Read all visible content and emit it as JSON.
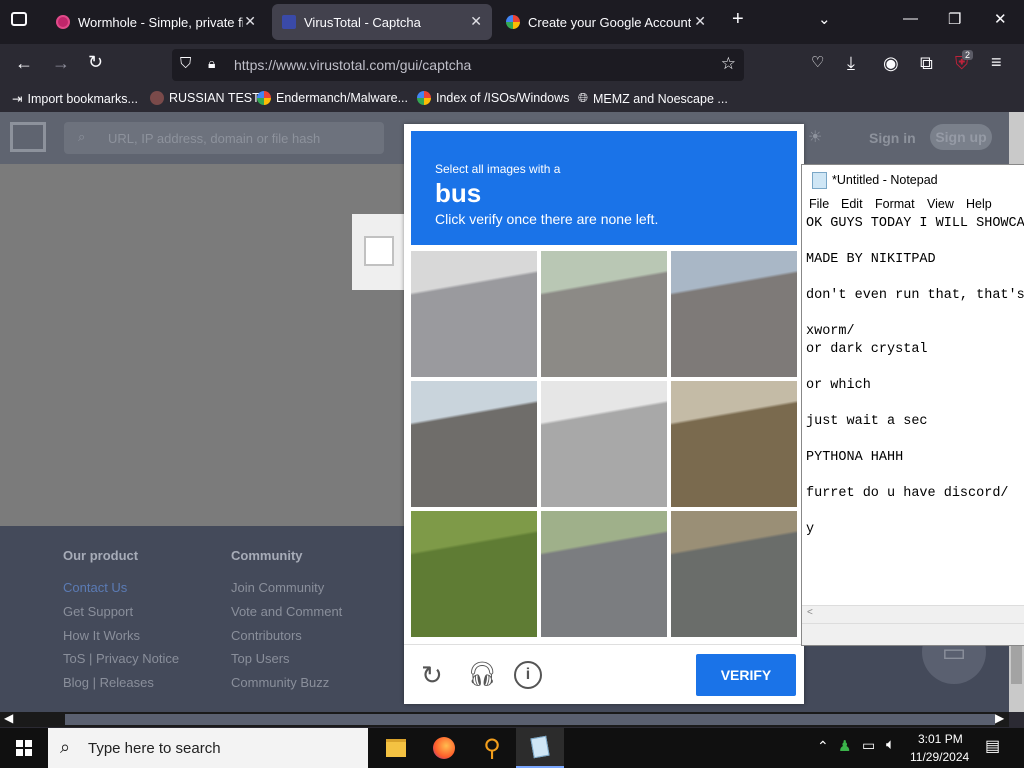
{
  "browser": {
    "tabs": [
      {
        "title": "Wormhole - Simple, private file",
        "active": false
      },
      {
        "title": "VirusTotal - Captcha",
        "active": true
      },
      {
        "title": "Create your Google Account",
        "active": false
      }
    ],
    "url": "https://www.virustotal.com/gui/captcha",
    "extension_badge": "2",
    "bookmarks": [
      "Import bookmarks...",
      "RUSSIAN TEST",
      "Endermanch/Malware...",
      "Index of /ISOs/Windows",
      "MEMZ and Noescape ..."
    ]
  },
  "page": {
    "search_placeholder": "URL, IP address, domain or file hash",
    "sign_in": "Sign in",
    "sign_up": "Sign up",
    "footer": {
      "product_heading": "Our product",
      "product_links": [
        "Contact Us",
        "Get Support",
        "How It Works",
        "ToS | Privacy Notice",
        "Blog | Releases"
      ],
      "community_heading": "Community",
      "community_links": [
        "Join Community",
        "Vote and Comment",
        "Contributors",
        "Top Users",
        "Community Buzz"
      ]
    }
  },
  "captcha": {
    "instruction": "Select all images with a",
    "target": "bus",
    "hint": "Click verify once there are none left.",
    "verify_label": "VERIFY",
    "tiles": [
      {
        "name": "crosswalk-road",
        "c1": "#9a9a9e",
        "c2": "#d8d8d8"
      },
      {
        "name": "street-bus",
        "c1": "#8c8a86",
        "c2": "#b9c7b4"
      },
      {
        "name": "intersection",
        "c1": "#7e7a78",
        "c2": "#a9b7c6"
      },
      {
        "name": "traffic-lights",
        "c1": "#6f6d6a",
        "c2": "#c9d4dc"
      },
      {
        "name": "crosswalk-lines",
        "c1": "#a8a8a8",
        "c2": "#e6e6e6"
      },
      {
        "name": "building-wall",
        "c1": "#7a6a4e",
        "c2": "#c4bba6"
      },
      {
        "name": "hydrant-grass",
        "c1": "#5f7c34",
        "c2": "#7e9a48"
      },
      {
        "name": "parking-road",
        "c1": "#7b7d80",
        "c2": "#9fb08a"
      },
      {
        "name": "apartment-lot",
        "c1": "#6a6d6a",
        "c2": "#9a8f76"
      }
    ]
  },
  "notepad": {
    "title": "*Untitled - Notepad",
    "menu": [
      "File",
      "Edit",
      "Format",
      "View",
      "Help"
    ],
    "lines": [
      "OK GUYS TODAY I WILL SHOWCAS",
      "",
      "MADE BY NIKITPAD",
      "",
      "don't even run that, that's",
      "",
      "xworm/",
      "or dark crystal",
      "",
      "or which",
      "",
      "just wait a sec",
      "",
      "PYTHONA HAHH",
      "",
      "furret do u have discord/",
      "",
      "y"
    ]
  },
  "taskbar": {
    "search_placeholder": "Type here to search",
    "time": "3:01 PM",
    "date": "11/29/2024"
  },
  "colors": {
    "accent": "#1a73e8"
  }
}
